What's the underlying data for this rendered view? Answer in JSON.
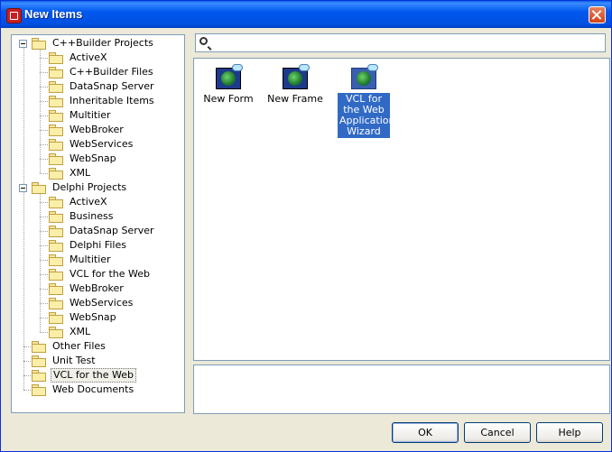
{
  "window": {
    "title": "New Items"
  },
  "search": {
    "placeholder": "",
    "value": ""
  },
  "tree": {
    "groups": [
      {
        "label": "C++Builder Projects",
        "expanded": true,
        "children": [
          "ActiveX",
          "C++Builder Files",
          "DataSnap Server",
          "Inheritable Items",
          "Multitier",
          "WebBroker",
          "WebServices",
          "WebSnap",
          "XML"
        ]
      },
      {
        "label": "Delphi Projects",
        "expanded": true,
        "children": [
          "ActiveX",
          "Business",
          "DataSnap Server",
          "Delphi Files",
          "Multitier",
          "VCL for the Web",
          "WebBroker",
          "WebServices",
          "WebSnap",
          "XML"
        ]
      }
    ],
    "roots": [
      "Other Files",
      "Unit Test",
      "VCL for the Web",
      "Web Documents"
    ],
    "selected": "VCL for the Web"
  },
  "items": [
    {
      "label": "New Form",
      "icon": "vcl-web-form-icon"
    },
    {
      "label": "New Frame",
      "icon": "vcl-web-frame-icon"
    },
    {
      "label": "VCL for the Web Application Wizard",
      "icon": "vcl-web-wizard-icon",
      "selected": true
    }
  ],
  "buttons": {
    "ok": "OK",
    "cancel": "Cancel",
    "help": "Help"
  }
}
